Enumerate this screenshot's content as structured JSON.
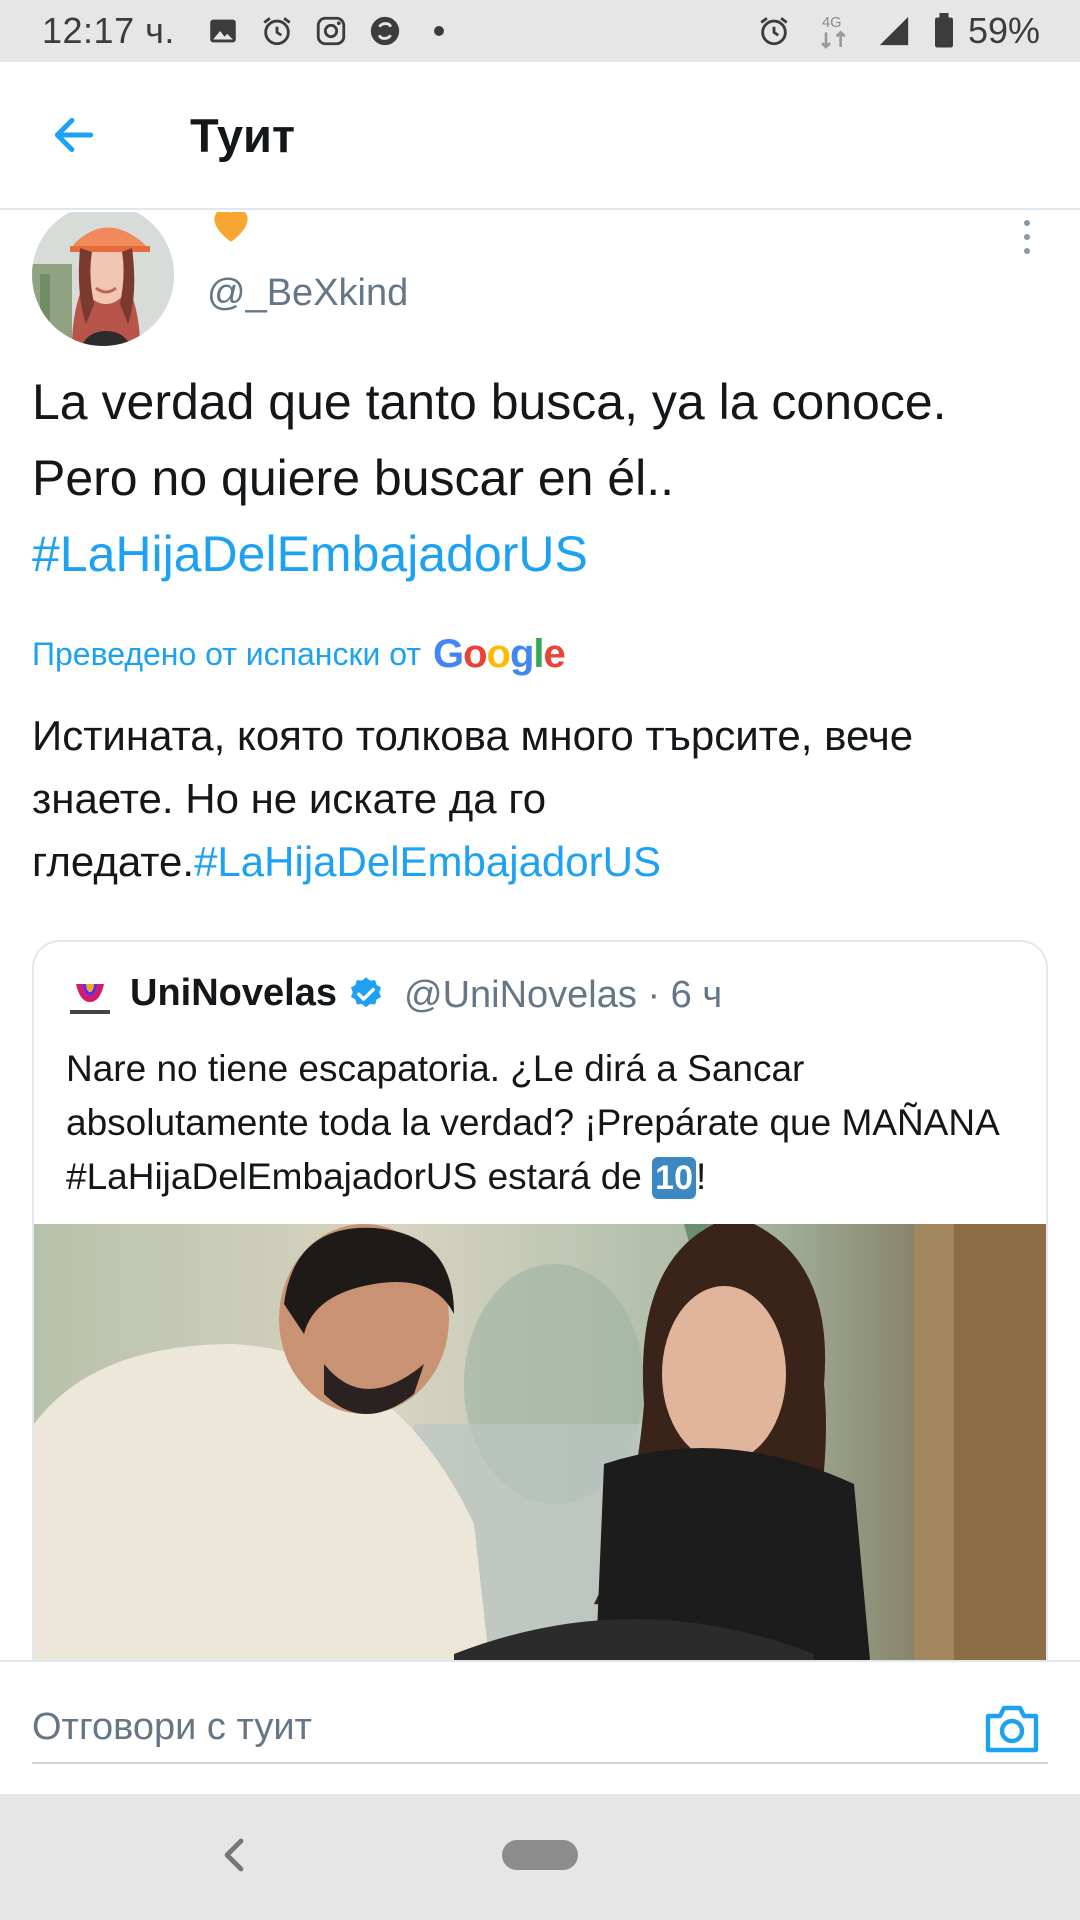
{
  "status_bar": {
    "time": "12:17 ч.",
    "left_icons": [
      "image-icon",
      "alarm-icon",
      "instagram-icon",
      "app-icon",
      "dot-icon"
    ],
    "network": "4G",
    "battery": "59%"
  },
  "header": {
    "title": "Туит"
  },
  "tweet": {
    "author_badge": "orange-heart",
    "handle": "@_BeXkind",
    "text_before": "La verdad que tanto busca, ya la conoce. Pero no quiere buscar en él..",
    "hashtag": "#LaHijaDelEmbajadorUS",
    "translated_label": "Преведено от испански от",
    "translation_provider": "Google",
    "translation_before": "Истината, която толкова много търсите, вече знаете. Но не искате да го гледате.",
    "translation_hashtag": "#LaHijaDelEmbajadorUS"
  },
  "quoted_tweet": {
    "name": "UniNovelas",
    "handle_time": "@UniNovelas · 6 ч",
    "text_before": "Nare no tiene escapatoria.  ¿Le dirá a Sancar absolutamente toda la verdad? ¡Prepárate que MAÑANA #LaHijaDelEmbajadorUS estará de ",
    "keycap": "10",
    "text_after": "!"
  },
  "reply": {
    "placeholder": "Отговори с туит"
  },
  "colors": {
    "accent": "#1da1f2",
    "text": "#14171a",
    "secondary": "#657786",
    "border": "#e1e8ed"
  }
}
